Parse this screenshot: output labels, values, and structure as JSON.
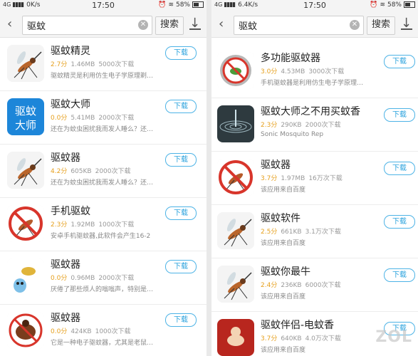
{
  "left": {
    "status": {
      "network": "4G",
      "speed": "0K/s",
      "time": "17:50",
      "battery": "58%"
    },
    "search": {
      "value": "驱蚊",
      "button": "搜索"
    },
    "apps": [
      {
        "name": "驱蚊精灵",
        "score": "2.7分",
        "size": "1.46MB",
        "downloads": "5000次下载",
        "desc": "驱蚊精灵是利用仿生电子学原理剃…",
        "button": "下载",
        "icon": "mosquito-icon"
      },
      {
        "name": "驱蚊大师",
        "score": "0.0分",
        "size": "5.41MB",
        "downloads": "2000次下载",
        "desc": "还在为蚊虫困扰我而发人睡么？还…",
        "button": "下载",
        "icon": "text-logo-icon",
        "icon_text": "驱蚊大师"
      },
      {
        "name": "驱蚊器",
        "score": "4.2分",
        "size": "605KB",
        "downloads": "2000次下载",
        "desc": "还在为蚊虫困扰我而发人睡么？还…",
        "button": "下载",
        "icon": "mosquito-icon"
      },
      {
        "name": "手机驱蚊",
        "score": "2.3分",
        "size": "1.92MB",
        "downloads": "1000次下载",
        "desc": "安卓手机驱蚊器,此软件会产生16-2",
        "button": "下载",
        "icon": "no-mosquito-icon"
      },
      {
        "name": "驱蚊器",
        "score": "0.0分",
        "size": "0.96MB",
        "downloads": "2000次下载",
        "desc": "厌倦了那些烦人的嗡嗡声，特别是…",
        "button": "下载",
        "icon": "cartoon-icon"
      },
      {
        "name": "驱蚊器",
        "score": "0.0分",
        "size": "424KB",
        "downloads": "1000次下载",
        "desc": "它是一种电子驱蚊器，尤其是老鼠…",
        "button": "下载",
        "icon": "bug-icon"
      }
    ]
  },
  "right": {
    "status": {
      "network": "4G",
      "speed": "6.4K/s",
      "time": "17:50",
      "battery": "58%"
    },
    "search": {
      "value": "驱蚊",
      "button": "搜索"
    },
    "apps": [
      {
        "name": "多功能驱蚊器",
        "score": "3.0分",
        "size": "4.53MB",
        "downloads": "3000次下载",
        "desc": "手机驱蚊器是利用仿生电子学原理…",
        "button": "下载",
        "icon": "badge-icon"
      },
      {
        "name": "驱蚊大师之不用买蚊香",
        "score": "2.3分",
        "size": "290KB",
        "downloads": "2000次下载",
        "desc": "Sonic Mosquito Rep",
        "button": "下载",
        "icon": "ripple-icon"
      },
      {
        "name": "驱蚊器",
        "score": "3.7分",
        "size": "1.97MB",
        "downloads": "16万次下载",
        "desc": "该应用来自百度",
        "button": "下载",
        "icon": "no-mosquito-icon"
      },
      {
        "name": "驱蚊软件",
        "score": "2.5分",
        "size": "661KB",
        "downloads": "3.1万次下载",
        "desc": "该应用来自百度",
        "button": "下载",
        "icon": "mosquito-icon"
      },
      {
        "name": "驱蚊你最牛",
        "score": "2.4分",
        "size": "236KB",
        "downloads": "6000次下载",
        "desc": "该应用来自百度",
        "button": "下载",
        "icon": "mosquito-icon"
      },
      {
        "name": "驱蚊伴侣-电蚊香",
        "score": "3.7分",
        "size": "640KB",
        "downloads": "4.0万次下载",
        "desc": "该应用来自百度",
        "button": "下载",
        "icon": "red-icon"
      }
    ]
  },
  "watermark": "ZOL"
}
